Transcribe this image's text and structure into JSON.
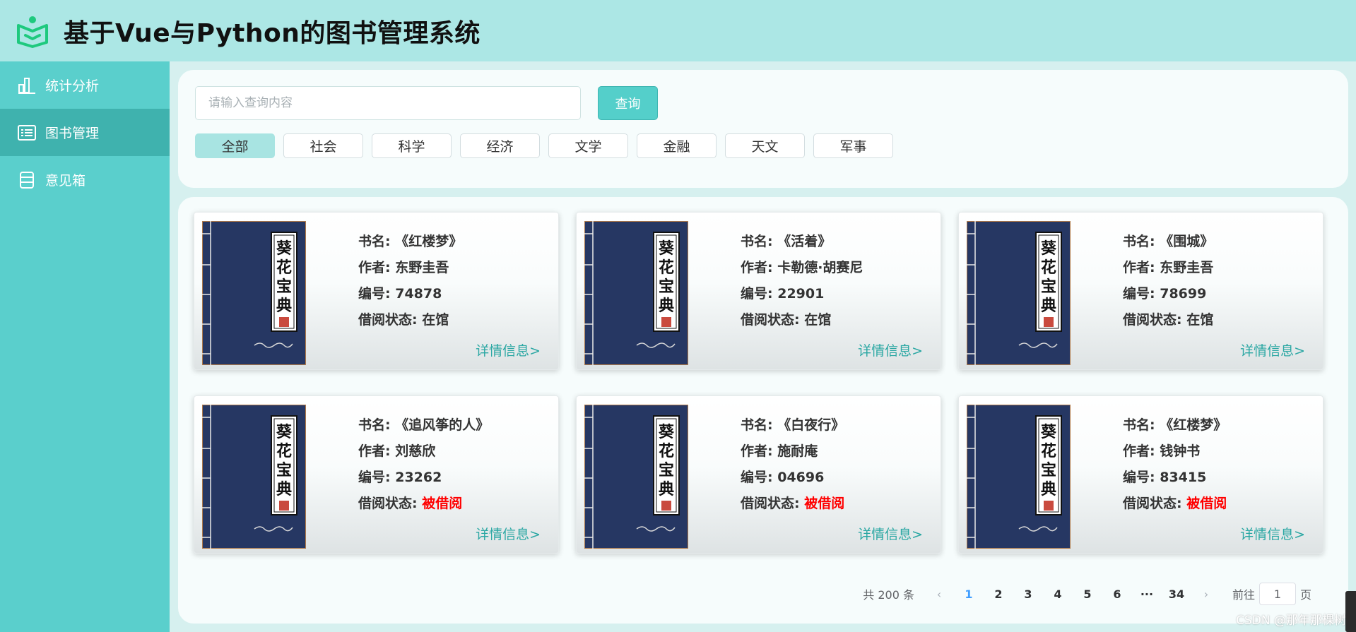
{
  "header": {
    "title": "基于Vue与Python的图书管理系统",
    "logo_icon": "book-open-icon",
    "accent_color": "#1ec97e"
  },
  "sidebar": {
    "items": [
      {
        "label": "统计分析",
        "icon": "bar-chart-icon",
        "active": false
      },
      {
        "label": "图书管理",
        "icon": "list-icon",
        "active": true
      },
      {
        "label": "意见箱",
        "icon": "inbox-icon",
        "active": false
      }
    ]
  },
  "search": {
    "placeholder": "请输入查询内容",
    "value": "",
    "button_label": "查询"
  },
  "categories": [
    {
      "label": "全部",
      "active": true
    },
    {
      "label": "社会",
      "active": false
    },
    {
      "label": "科学",
      "active": false
    },
    {
      "label": "经济",
      "active": false
    },
    {
      "label": "文学",
      "active": false
    },
    {
      "label": "金融",
      "active": false
    },
    {
      "label": "天文",
      "active": false
    },
    {
      "label": "军事",
      "active": false
    }
  ],
  "book_labels": {
    "name": "书名: ",
    "author": "作者: ",
    "id": "编号: ",
    "status": "借阅状态: ",
    "detail_link": "详情信息>"
  },
  "books": [
    {
      "name": "《红楼梦》",
      "author": "东野圭吾",
      "id": "74878",
      "status": "在馆"
    },
    {
      "name": "《活着》",
      "author": "卡勒德·胡赛尼",
      "id": "22901",
      "status": "在馆"
    },
    {
      "name": "《围城》",
      "author": "东野圭吾",
      "id": "78699",
      "status": "在馆"
    },
    {
      "name": "《追风筝的人》",
      "author": "刘慈欣",
      "id": "23262",
      "status": "被借阅"
    },
    {
      "name": "《白夜行》",
      "author": "施耐庵",
      "id": "04696",
      "status": "被借阅"
    },
    {
      "name": "《红楼梦》",
      "author": "钱钟书",
      "id": "83415",
      "status": "被借阅"
    }
  ],
  "book_cover": {
    "title_chars": [
      "葵",
      "花",
      "宝",
      "典"
    ],
    "cover_color": "#263763",
    "seal_color": "#c94a3e"
  },
  "pagination": {
    "total_text": "共 200 条",
    "pages": [
      "1",
      "2",
      "3",
      "4",
      "5",
      "6",
      "···",
      "34"
    ],
    "current": "1",
    "prev_icon": "chevron-left-icon",
    "next_icon": "chevron-right-icon",
    "goto_prefix": "前往",
    "goto_value": "1",
    "goto_suffix": "页"
  },
  "status_colors": {
    "在馆": "#333333",
    "被借阅": "#ff0000"
  },
  "watermark": "CSDN @那年那棵树"
}
